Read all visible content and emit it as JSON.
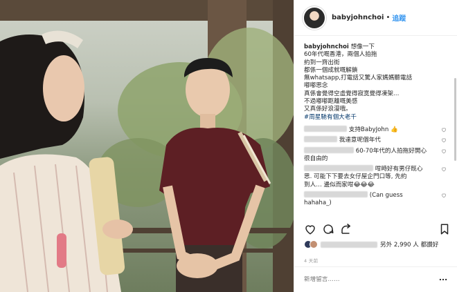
{
  "post": {
    "username": "babyjohnchoi",
    "dot": "•",
    "follow_label": "追蹤"
  },
  "caption": {
    "username": "babyjohnchoi",
    "lines": [
      "想像一下",
      "60年代嘅香港，兩個人拍拖",
      "約到一齊出街",
      "都係一個成就嘅解鎖",
      "無whatsapp,打電話又驚人家媽媽聽電話",
      "嘟嘟思念",
      "真係會覺得空虛覺得寂寞覺得凍架…",
      "不過嘟嘟距離嘅美感",
      "又真係好浪漫哦。"
    ],
    "hashtag": "#周星馳有個大老千"
  },
  "comments": [
    {
      "text": "支持BabyJohn 👍"
    },
    {
      "text": "我達意呢個年代"
    },
    {
      "text": "60-70年代的人拍拖好開心",
      "line2": "很自由的"
    },
    {
      "text": "咁時好有男仔既心",
      "line2": "思. 可能下下要去女仔屋企門口等, 先約",
      "line3": "到人… 邊似而家咁😂😂😂"
    },
    {
      "text": "(Can guess",
      "line2": "hahaha_)"
    }
  ],
  "likes": {
    "text": "另外 2,990 人 都讚好"
  },
  "time": "4 天前",
  "add_comment": {
    "placeholder": "新增留言……"
  },
  "icons": [
    "heart-icon",
    "comment-icon",
    "share-icon",
    "bookmark-icon",
    "more-icon"
  ],
  "colors": {
    "accent": "#3897f0",
    "hashtag": "#003569",
    "text": "#262626"
  }
}
